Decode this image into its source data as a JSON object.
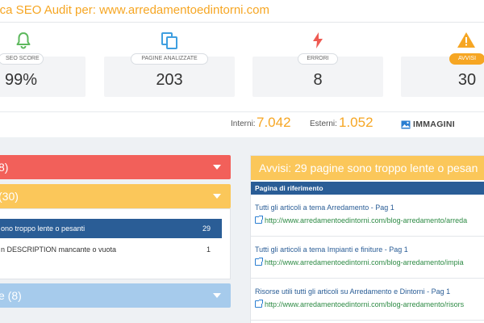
{
  "header": {
    "title": "nica SEO Audit per: www.arredamentoedintorni.com"
  },
  "stats": [
    {
      "label": "SEO SCORE",
      "value": "99%",
      "icon": "bell-icon"
    },
    {
      "label": "PAGINE ANALIZZATE",
      "value": "203",
      "icon": "copy-icon"
    },
    {
      "label": "ERRORI",
      "value": "8",
      "icon": "lightning-icon"
    },
    {
      "label": "AVVISI",
      "value": "30",
      "icon": "warning-icon"
    }
  ],
  "links": {
    "interni_label": "Interni:",
    "interni_value": "7.042",
    "esterni_label": "Esterni:",
    "esterni_value": "1.052",
    "images_label": "IMMAGINI"
  },
  "left": {
    "errors_header": "8)",
    "warnings_header": "(30)",
    "notices_header": "e (8)",
    "items": [
      {
        "label": "ono troppo lente o pesanti",
        "count": "29"
      },
      {
        "label": "n DESCRIPTION mancante o vuota",
        "count": "1"
      }
    ]
  },
  "right": {
    "header": "Avvisi: 29 pagine sono troppo lente o pesan",
    "subheader": "Pagina di riferimento",
    "rows": [
      {
        "title": "Tutti gli articoli a tema Arredamento - Pag 1",
        "url": "http://www.arredamentoedintorni.com/blog-arredamento/arreda"
      },
      {
        "title": "Tutti gli articoli a tema Impianti e finiture - Pag 1",
        "url": "http://www.arredamentoedintorni.com/blog-arredamento/impia"
      },
      {
        "title": "Risorse utili tutti gli articoli su Arredamento e Dintorni - Pag 1",
        "url": "http://www.arredamentoedintorni.com/blog-arredamento/risors"
      }
    ]
  },
  "colors": {
    "accent": "#f6a623",
    "error": "#f2605a",
    "warning": "#fbc75a",
    "notice": "#a6cbec",
    "primary": "#2a5d96",
    "success": "#2e8b45"
  }
}
